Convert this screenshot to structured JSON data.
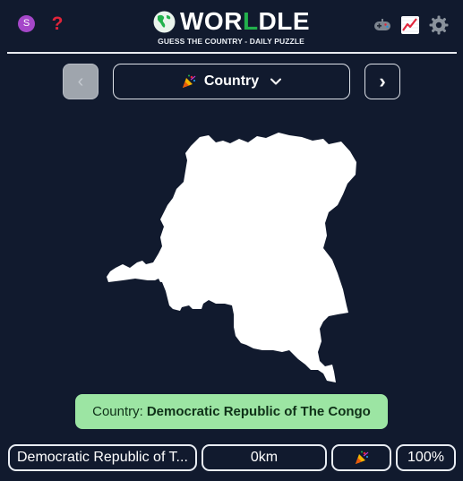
{
  "header": {
    "avatar_letter": "S",
    "help_glyph": "?",
    "logo": {
      "part1": "WOR",
      "accent": "L",
      "part2": "DLE"
    },
    "subtitle": "GUESS THE COUNTRY - DAILY PUZZLE",
    "icons": [
      "avatar",
      "help-icon",
      "globe-icon",
      "gamepad-icon",
      "stats-chart-icon",
      "gear-icon"
    ]
  },
  "nav": {
    "prev_glyph": "‹",
    "mode_label": "Country",
    "mode_icon": "party-popper-icon",
    "dropdown_icon": "chevron-down-icon",
    "next_glyph": "›"
  },
  "answer": {
    "prefix": "Country:",
    "name": "Democratic Republic of The Congo"
  },
  "guess": {
    "name": "Democratic Republic of T...",
    "distance": "0km",
    "direction_icon": "party-popper-icon",
    "proximity": "100%"
  },
  "colors": {
    "background": "#111a2e",
    "accent_green": "#22b14c",
    "banner_green": "#9ce5a3",
    "avatar_purple": "#a547c9",
    "help_red": "#e0243a"
  }
}
